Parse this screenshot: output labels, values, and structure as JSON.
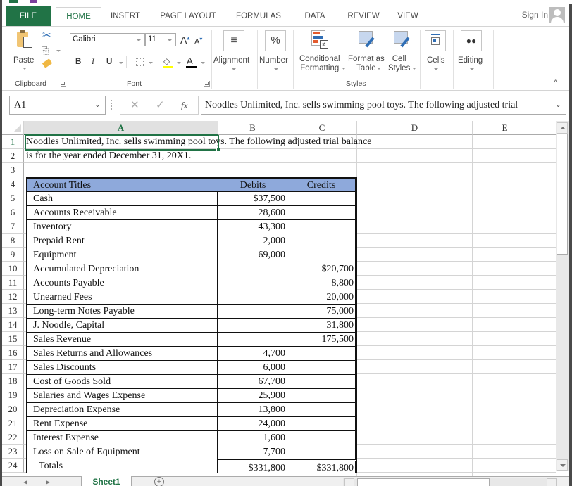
{
  "ribbon_tabs": {
    "file": "FILE",
    "home": "HOME",
    "insert": "INSERT",
    "page_layout": "PAGE LAYOUT",
    "formulas": "FORMULAS",
    "data": "DATA",
    "review": "REVIEW",
    "view": "VIEW",
    "active": "HOME"
  },
  "account": {
    "sign_in": "Sign In"
  },
  "ribbon": {
    "clipboard": {
      "paste": "Paste",
      "group_label": "Clipboard"
    },
    "font": {
      "font_name": "Calibri",
      "font_size": "11",
      "grow": "A",
      "shrink": "A",
      "bold": "B",
      "italic": "I",
      "underline": "U",
      "font_color_letter": "A",
      "group_label": "Font"
    },
    "alignment": {
      "label": "Alignment",
      "icon_glyph": "≡"
    },
    "number": {
      "label": "Number",
      "icon_glyph": "%"
    },
    "styles": {
      "conditional_formatting_line1": "Conditional",
      "conditional_formatting_line2": "Formatting",
      "format_as_table_line1": "Format as",
      "format_as_table_line2": "Table",
      "cell_styles_line1": "Cell",
      "cell_styles_line2": "Styles",
      "group_label": "Styles"
    },
    "cells": {
      "label": "Cells"
    },
    "editing": {
      "label": "Editing"
    }
  },
  "formula_bar": {
    "name_box": "A1",
    "fx_label": "fx",
    "cancel_glyph": "✕",
    "enter_glyph": "✓",
    "content": "Noodles Unlimited, Inc. sells swimming pool toys.  The following adjusted trial"
  },
  "columns": [
    "A",
    "B",
    "C",
    "D",
    "E"
  ],
  "selected_cell": "A1",
  "rows": [
    "1",
    "2",
    "3",
    "4",
    "5",
    "6",
    "7",
    "8",
    "9",
    "10",
    "11",
    "12",
    "13",
    "14",
    "15",
    "16",
    "17",
    "18",
    "19",
    "20",
    "21",
    "22",
    "23",
    "24"
  ],
  "intro": {
    "line1": "Noodles Unlimited, Inc. sells swimming pool toys.  The following adjusted trial balance",
    "line2": "is for the year ended December 31, 20X1."
  },
  "trial_balance": {
    "headers": {
      "account": "Account Titles",
      "debits": "Debits",
      "credits": "Credits"
    },
    "header_color": "#8ea9db",
    "rows": [
      {
        "account": "Cash",
        "debit": "$37,500",
        "credit": ""
      },
      {
        "account": "Accounts Receivable",
        "debit": "28,600",
        "credit": ""
      },
      {
        "account": "Inventory",
        "debit": "43,300",
        "credit": ""
      },
      {
        "account": "Prepaid Rent",
        "debit": "2,000",
        "credit": ""
      },
      {
        "account": "Equipment",
        "debit": "69,000",
        "credit": ""
      },
      {
        "account": "Accumulated Depreciation",
        "debit": "",
        "credit": "$20,700"
      },
      {
        "account": "Accounts Payable",
        "debit": "",
        "credit": "8,800"
      },
      {
        "account": "Unearned Fees",
        "debit": "",
        "credit": "20,000"
      },
      {
        "account": "Long-term Notes Payable",
        "debit": "",
        "credit": "75,000"
      },
      {
        "account": "J. Noodle, Capital",
        "debit": "",
        "credit": "31,800"
      },
      {
        "account": "Sales Revenue",
        "debit": "",
        "credit": "175,500"
      },
      {
        "account": "Sales Returns and Allowances",
        "debit": "4,700",
        "credit": ""
      },
      {
        "account": "Sales Discounts",
        "debit": "6,000",
        "credit": ""
      },
      {
        "account": "Cost of Goods Sold",
        "debit": "67,700",
        "credit": ""
      },
      {
        "account": "Salaries and Wages Expense",
        "debit": "25,900",
        "credit": ""
      },
      {
        "account": "Depreciation Expense",
        "debit": "13,800",
        "credit": ""
      },
      {
        "account": "Rent Expense",
        "debit": "24,000",
        "credit": ""
      },
      {
        "account": "Interest Expense",
        "debit": "1,600",
        "credit": ""
      },
      {
        "account": "Loss on Sale of Equipment",
        "debit": "7,700",
        "credit": ""
      }
    ],
    "totals": {
      "label": "Totals",
      "debit": "$331,800",
      "credit": "$331,800"
    }
  },
  "sheets": {
    "tabs": [
      "Sheet1"
    ],
    "active": "Sheet1",
    "add_glyph": "+"
  },
  "colors": {
    "excel_green": "#217346",
    "header_blue": "#8ea9db"
  }
}
